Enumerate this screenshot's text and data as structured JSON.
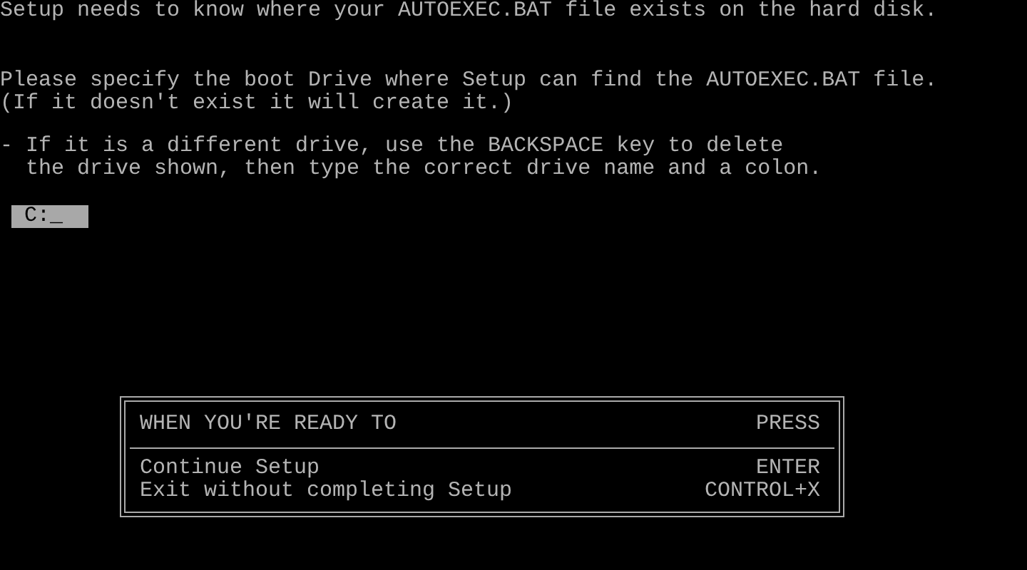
{
  "messages": [
    {
      "lines": [
        "Setup needs to know where your AUTOEXEC.BAT file exists on the hard disk."
      ]
    },
    {
      "lines": [
        "Please specify the boot Drive where Setup can find the AUTOEXEC.BAT file.",
        "(If it doesn't exist it will create it.)"
      ]
    },
    {
      "lines": [
        "- If it is a different drive, use the BACKSPACE key to delete",
        "  the drive shown, then type the correct drive name and a colon."
      ]
    }
  ],
  "drive_field": {
    "value": "C:",
    "cursor": "_"
  },
  "key_box": {
    "header": {
      "action": "WHEN YOU'RE READY TO",
      "key": "PRESS"
    },
    "rows": [
      {
        "action": "Continue Setup",
        "key": "ENTER"
      },
      {
        "action": "Exit without completing Setup",
        "key": "CONTROL+X"
      }
    ]
  }
}
